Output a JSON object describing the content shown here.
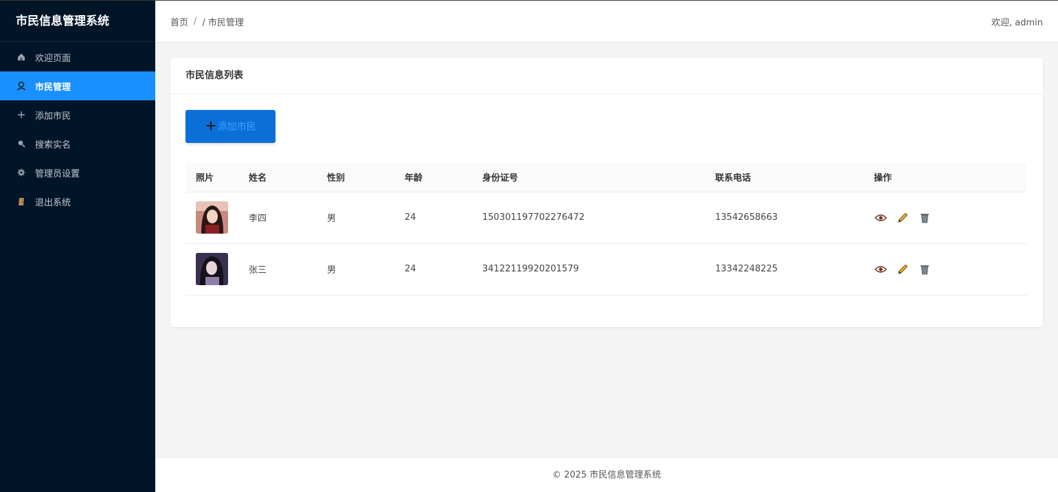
{
  "app": {
    "title": "市民信息管理系统"
  },
  "sidebar": {
    "items": [
      {
        "label": "欢迎页面",
        "icon": "home-icon",
        "active": false
      },
      {
        "label": "市民管理",
        "icon": "user-icon",
        "active": true
      },
      {
        "label": "添加市民",
        "icon": "plus-icon",
        "active": false
      },
      {
        "label": "搜索实名",
        "icon": "search-icon",
        "active": false
      },
      {
        "label": "管理员设置",
        "icon": "gear-icon",
        "active": false
      },
      {
        "label": "退出系统",
        "icon": "door-icon",
        "active": false
      }
    ]
  },
  "header": {
    "breadcrumb": {
      "home": "首页",
      "sep": "/",
      "current": "/ 市民管理"
    },
    "welcome": "欢迎, admin"
  },
  "card": {
    "title": "市民信息列表",
    "add_button": {
      "icon": "plus-icon",
      "label": "添加市民"
    }
  },
  "table": {
    "columns": [
      "照片",
      "姓名",
      "性别",
      "年龄",
      "身份证号",
      "联系电话",
      "操作"
    ],
    "rows": [
      {
        "photo": "avatar-photo",
        "name": "李四",
        "gender": "男",
        "age": "24",
        "id_number": "150301197702276472",
        "phone": "13542658663",
        "actions": [
          "view-icon",
          "edit-icon",
          "delete-icon"
        ]
      },
      {
        "photo": "avatar-photo",
        "name": "张三",
        "gender": "男",
        "age": "24",
        "id_number": "34122119920201579",
        "phone": "13342248225",
        "actions": [
          "view-icon",
          "edit-icon",
          "delete-icon"
        ]
      }
    ]
  },
  "footer": {
    "text": "© 2025 市民信息管理系统"
  },
  "colors": {
    "sidebar_bg": "#011529",
    "active_menu": "#1890ff",
    "primary_button": "#0b6fd8",
    "page_bg": "#f4f4f4"
  }
}
